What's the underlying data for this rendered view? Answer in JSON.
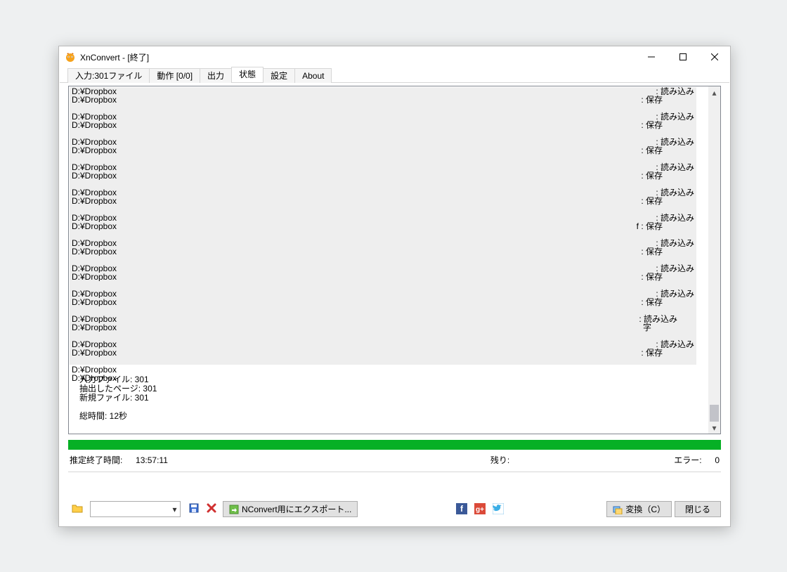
{
  "window": {
    "title": "XnConvert - [終了]"
  },
  "tabs": {
    "input": "入力:301ファイル",
    "actions": "動作 [0/0]",
    "output": "出力",
    "status": "状態",
    "settings": "設定",
    "about": "About"
  },
  "log": {
    "pair_left": "D:¥Dropbox",
    "right_read": ": 読み込み",
    "right_save": ": 保存",
    "right_save_f": "f : 保存",
    "right_zi": "字",
    "summary_input": "入力ファイル: 301",
    "summary_pages": "抽出したページ: 301",
    "summary_new": "新規ファイル: 301",
    "summary_blank": "",
    "summary_total": "総時間: 12秒"
  },
  "status": {
    "est_label": "推定終了時間:",
    "est_value": "13:57:11",
    "remain_label": "残り:",
    "remain_value": "",
    "error_label": "エラー:",
    "error_value": "0"
  },
  "buttons": {
    "export": "NConvert用にエクスポート...",
    "convert": "変換（C）",
    "close": "閉じる"
  },
  "icons": {
    "folder": "folder-icon",
    "save": "save-icon",
    "delete": "delete-icon",
    "facebook": "facebook-icon",
    "gplus": "gplus-icon",
    "twitter": "twitter-icon",
    "convert": "convert-icon",
    "export": "export-icon"
  }
}
